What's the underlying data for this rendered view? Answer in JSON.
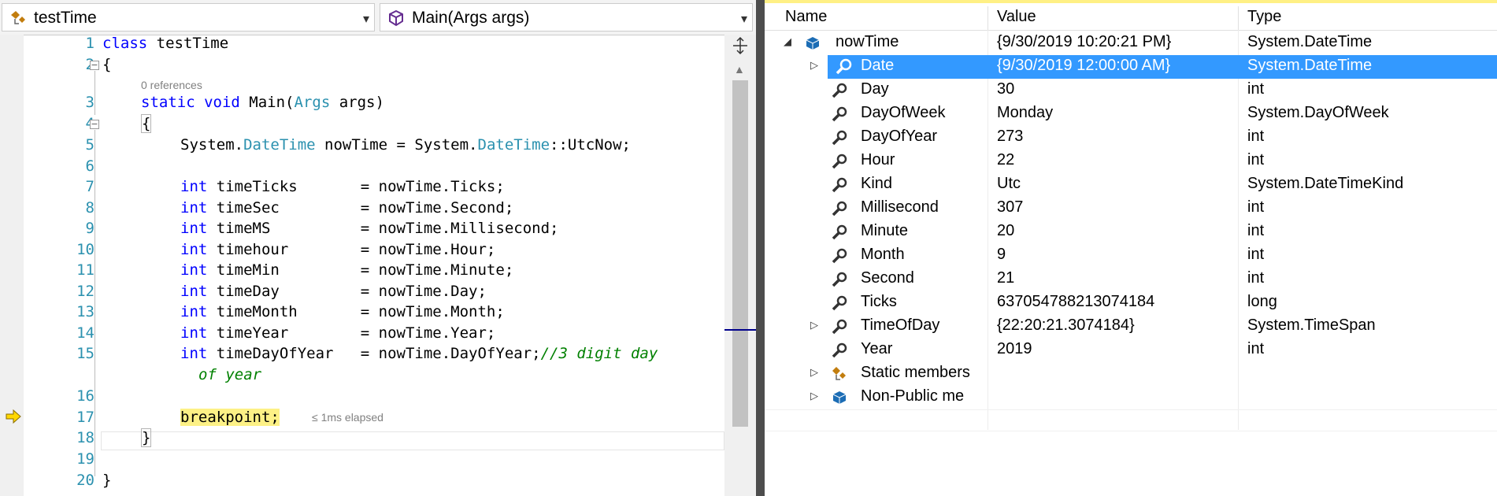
{
  "editor": {
    "nav_left_label": "testTime",
    "nav_right_label": "Main(Args args)",
    "line_numbers": [
      "1",
      "2",
      "3",
      "4",
      "5",
      "6",
      "7",
      "8",
      "9",
      "10",
      "11",
      "12",
      "13",
      "14",
      "15",
      "16",
      "17",
      "18",
      "19",
      "20"
    ],
    "references_hint": "0 references",
    "elapsed_hint": "≤ 1ms elapsed",
    "code": {
      "l1_kw": "class",
      "l1_name": " testTime",
      "l2": "{",
      "l3_static": "static",
      "l3_void": "void",
      "l3_main": " Main(",
      "l3_args": "Args",
      "l3_rest": " args)",
      "l4": "{",
      "l5_a": "System.",
      "l5_b": "DateTime",
      "l5_c": " nowTime = System.",
      "l5_d": "DateTime",
      "l5_e": "::UtcNow;",
      "int_kw": "int",
      "l7": " timeTicks       = nowTime.Ticks;",
      "l8": " timeSec         = nowTime.Second;",
      "l9": " timeMS          = nowTime.Millisecond;",
      "l10": " timehour        = nowTime.Hour;",
      "l11": " timeMin         = nowTime.Minute;",
      "l12": " timeDay         = nowTime.Day;",
      "l13": " timeMonth       = nowTime.Month;",
      "l14": " timeYear        = nowTime.Year;",
      "l15": " timeDayOfYear   = nowTime.DayOfYear;",
      "l15_comment": "//3 digit day",
      "l15_comment_wrap": "of year",
      "l17": "breakpoint;",
      "l18": "}",
      "l20": "}"
    }
  },
  "watch": {
    "headers": {
      "name": "Name",
      "value": "Value",
      "type": "Type"
    },
    "rows": [
      {
        "name": "nowTime",
        "value": "{9/30/2019 10:20:21 PM}",
        "type": "System.DateTime"
      },
      {
        "name": "Date",
        "value": "{9/30/2019 12:00:00 AM}",
        "type": "System.DateTime"
      },
      {
        "name": "Day",
        "value": "30",
        "type": "int"
      },
      {
        "name": "DayOfWeek",
        "value": "Monday",
        "type": "System.DayOfWeek"
      },
      {
        "name": "DayOfYear",
        "value": "273",
        "type": "int"
      },
      {
        "name": "Hour",
        "value": "22",
        "type": "int"
      },
      {
        "name": "Kind",
        "value": "Utc",
        "type": "System.DateTimeKind"
      },
      {
        "name": "Millisecond",
        "value": "307",
        "type": "int"
      },
      {
        "name": "Minute",
        "value": "20",
        "type": "int"
      },
      {
        "name": "Month",
        "value": "9",
        "type": "int"
      },
      {
        "name": "Second",
        "value": "21",
        "type": "int"
      },
      {
        "name": "Ticks",
        "value": "637054788213074184",
        "type": "long"
      },
      {
        "name": "TimeOfDay",
        "value": "{22:20:21.3074184}",
        "type": "System.TimeSpan"
      },
      {
        "name": "Year",
        "value": "2019",
        "type": "int"
      },
      {
        "name": "Static members",
        "value": "",
        "type": ""
      },
      {
        "name": "Non-Public me",
        "value": "",
        "type": ""
      }
    ]
  },
  "colors": {
    "selection": "#3399ff",
    "breakpoint_highlight": "#fdf186",
    "line_number": "#2b91af",
    "keyword": "#0000ff",
    "type": "#2b91af",
    "comment": "#008000"
  }
}
